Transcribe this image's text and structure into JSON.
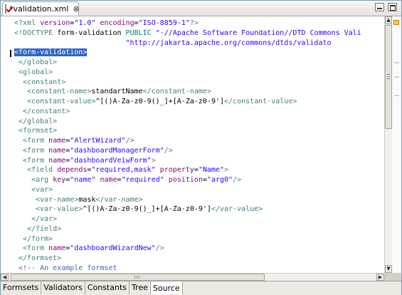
{
  "editor_tab": {
    "title": "*validation.xml",
    "close_glyph": "⊗",
    "icon": "xml-file-icon"
  },
  "window_controls": {
    "minimize_icon": "minimize-icon",
    "maximize_icon": "maximize-icon"
  },
  "code_lines": [
    [
      {
        "s": "t",
        "x": "<?xml "
      },
      {
        "s": "a",
        "x": "version"
      },
      {
        "s": "txt",
        "x": "="
      },
      {
        "s": "v",
        "x": "\"1.0\" "
      },
      {
        "s": "a",
        "x": "encoding"
      },
      {
        "s": "txt",
        "x": "="
      },
      {
        "s": "v",
        "x": "\"ISO-8859-1\""
      },
      {
        "s": "t",
        "x": "?>"
      }
    ],
    [
      {
        "s": "t",
        "x": "<!DOCTYPE "
      },
      {
        "s": "txt",
        "x": "form-validation "
      },
      {
        "s": "p",
        "x": "PUBLIC "
      },
      {
        "s": "v",
        "x": "\"-//Apache Software Foundation//DTD Commons Vali"
      }
    ],
    [
      {
        "s": "v",
        "x": "                          \"http://jakarta.apache.org/commons/dtds/validato"
      }
    ],
    [
      {
        "s": "sel",
        "x": "<form-validation>"
      }
    ],
    [
      {
        "s": "t",
        "x": " </global>"
      }
    ],
    [
      {
        "s": "t",
        "x": " <global>"
      }
    ],
    [
      {
        "s": "t",
        "x": "  <constant>"
      }
    ],
    [
      {
        "s": "t",
        "x": "   <constant-name>"
      },
      {
        "s": "txt",
        "x": "standartName"
      },
      {
        "s": "t",
        "x": "</constant-name>"
      }
    ],
    [
      {
        "s": "t",
        "x": "   <constant-value>"
      },
      {
        "s": "txt",
        "x": "^[()A-Za-z0-9()_]+[A-Za-z0-9']"
      },
      {
        "s": "t",
        "x": "</constant-value>"
      }
    ],
    [
      {
        "s": "t",
        "x": "  </constant>"
      }
    ],
    [
      {
        "s": "t",
        "x": " </global>"
      }
    ],
    [
      {
        "s": "t",
        "x": " <formset>"
      }
    ],
    [
      {
        "s": "t",
        "x": "  <form "
      },
      {
        "s": "a",
        "x": "name"
      },
      {
        "s": "txt",
        "x": "="
      },
      {
        "s": "v",
        "x": "\"AlertWizard\""
      },
      {
        "s": "t",
        "x": "/>"
      }
    ],
    [
      {
        "s": "t",
        "x": "  <form "
      },
      {
        "s": "a",
        "x": "name"
      },
      {
        "s": "txt",
        "x": "="
      },
      {
        "s": "v",
        "x": "\"dashboardManagerForm\""
      },
      {
        "s": "t",
        "x": "/>"
      }
    ],
    [
      {
        "s": "t",
        "x": "  <form "
      },
      {
        "s": "a",
        "x": "name"
      },
      {
        "s": "txt",
        "x": "="
      },
      {
        "s": "v",
        "x": "\"dashboardVeiwForm\""
      },
      {
        "s": "t",
        "x": ">"
      }
    ],
    [
      {
        "s": "t",
        "x": "   <field "
      },
      {
        "s": "a",
        "x": "depends"
      },
      {
        "s": "txt",
        "x": "="
      },
      {
        "s": "v",
        "x": "\"required,mask\" "
      },
      {
        "s": "a",
        "x": "property"
      },
      {
        "s": "txt",
        "x": "="
      },
      {
        "s": "v",
        "x": "\"Name\""
      },
      {
        "s": "t",
        "x": ">"
      }
    ],
    [
      {
        "s": "t",
        "x": "    <arg "
      },
      {
        "s": "a",
        "x": "key"
      },
      {
        "s": "txt",
        "x": "="
      },
      {
        "s": "v",
        "x": "\"name\" "
      },
      {
        "s": "a",
        "x": "name"
      },
      {
        "s": "txt",
        "x": "="
      },
      {
        "s": "v",
        "x": "\"required\" "
      },
      {
        "s": "a",
        "x": "position"
      },
      {
        "s": "txt",
        "x": "="
      },
      {
        "s": "v",
        "x": "\"arg0\""
      },
      {
        "s": "t",
        "x": "/>"
      }
    ],
    [
      {
        "s": "t",
        "x": "    <var>"
      }
    ],
    [
      {
        "s": "t",
        "x": "     <var-name>"
      },
      {
        "s": "txt",
        "x": "mask"
      },
      {
        "s": "t",
        "x": "</var-name>"
      }
    ],
    [
      {
        "s": "t",
        "x": "     <var-value>"
      },
      {
        "s": "txt",
        "x": "^[()A-Za-z0-9()_]+[A-Za-z0-9']"
      },
      {
        "s": "t",
        "x": "</var-value>"
      }
    ],
    [
      {
        "s": "t",
        "x": "    </var>"
      }
    ],
    [
      {
        "s": "t",
        "x": "   </field>"
      }
    ],
    [
      {
        "s": "t",
        "x": "  </form>"
      }
    ],
    [
      {
        "s": "t",
        "x": "  <form "
      },
      {
        "s": "a",
        "x": "name"
      },
      {
        "s": "txt",
        "x": "="
      },
      {
        "s": "v",
        "x": "\"dashboardWizardNew\""
      },
      {
        "s": "t",
        "x": "/>"
      }
    ],
    [
      {
        "s": "t",
        "x": " </formset>"
      }
    ],
    [
      {
        "s": "c",
        "x": " <!-- An example formset"
      }
    ]
  ],
  "bottom_tabs": [
    {
      "label": "Formsets",
      "active": false
    },
    {
      "label": "Validators",
      "active": false
    },
    {
      "label": "Constants",
      "active": false
    },
    {
      "label": "Tree",
      "active": false
    },
    {
      "label": "Source",
      "active": true
    }
  ],
  "scrollbars": {
    "up_glyph": "▲",
    "down_glyph": "▼",
    "left_glyph": "◀",
    "right_glyph": "▶"
  },
  "colors": {
    "tag": "#3f7f7f",
    "attribute": "#7f007f",
    "value": "#2a00ff",
    "comment": "#3f5fbf",
    "selection": "#2f65ca"
  }
}
